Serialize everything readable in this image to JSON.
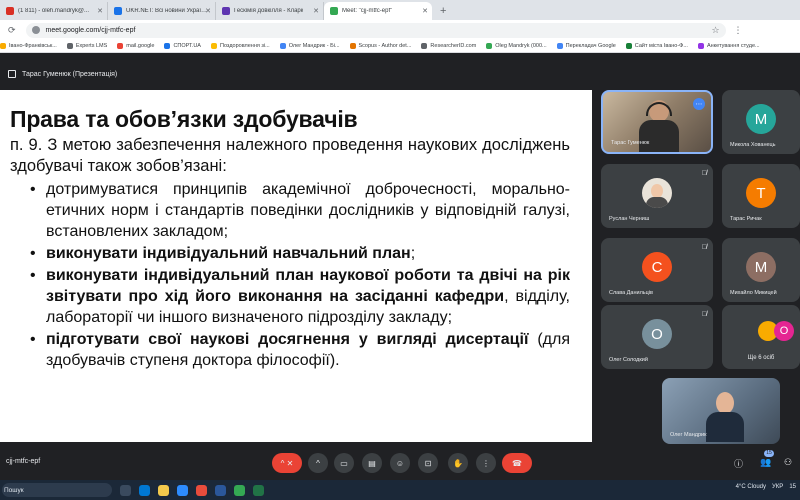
{
  "browser": {
    "tabs": [
      {
        "label": "(1 811) - oleh.mandryk@...",
        "color": "#d93025",
        "active": false
      },
      {
        "label": "UKR.NET: Всі новини України...",
        "color": "#1a73e8",
        "active": false
      },
      {
        "label": "Гескімія довкілля - Кларк",
        "color": "#5e35b1",
        "active": false
      },
      {
        "label": "Meet: \"cjj-mtfc-epf\"",
        "color": "#34a853",
        "active": true
      }
    ],
    "url": "meet.google.com/cjj-mtfc-epf",
    "bookmarks": [
      {
        "label": "Івано-Франківськ...",
        "color": "#f9ab00"
      },
      {
        "label": "Experts LMS",
        "color": "#5f6368"
      },
      {
        "label": "mail.google",
        "color": "#ea4335"
      },
      {
        "label": "СПОРТ.UA",
        "color": "#1a73e8"
      },
      {
        "label": "Поздоровлення зі...",
        "color": "#fbbc04"
      },
      {
        "label": "Олег Мандрик - Бі...",
        "color": "#4285f4"
      },
      {
        "label": "Scopus - Author det...",
        "color": "#e37400"
      },
      {
        "label": "ResearcherID.com",
        "color": "#5f6368"
      },
      {
        "label": "Oleg Mandryk (000...",
        "color": "#34a853"
      },
      {
        "label": "Перекладач Google",
        "color": "#4285f4"
      },
      {
        "label": "Сайт міста Івано-Ф...",
        "color": "#188038"
      },
      {
        "label": "Анкетування студе...",
        "color": "#9334e6"
      }
    ]
  },
  "meet": {
    "presenter": "Тарас Гуменюк (Презентація)",
    "meeting_code": "cjj-mtfc-epf",
    "participants_count": "15"
  },
  "slide": {
    "title": "Права та обов’язки здобувачів",
    "lead": "п. 9. З метою забезпечення належного проведення наукових досліджень здобувачі також зобов’язані:",
    "bullets": [
      {
        "text": "дотримуватися принципів академічної доброчесності, морально-етичних норм і стандартів поведінки дослідників у відповідній галузі, встановлених закладом;",
        "bold": "",
        "rest": ""
      },
      {
        "text": "",
        "bold": "виконувати індивідуальний навчальний план",
        "rest": ";"
      },
      {
        "text": "",
        "bold": "виконувати індивідуальний план наукової роботи та двічі на рік звітувати про хід його виконання на засіданні кафедри",
        "rest": ", відділу, лабораторії чи іншого визначеного підрозділу закладу;"
      },
      {
        "text": "",
        "bold": "підготувати свої наукові досягнення у вигляді дисертації",
        "rest": " (для здобувачів ступеня доктора філософії)."
      }
    ]
  },
  "participants": {
    "main": "Тарас Гуменюк",
    "mykola": {
      "name": "Микола Хованець",
      "initial": "M",
      "color": "#26a69a"
    },
    "ruslan": {
      "name": "Руслан Черниш"
    },
    "taras_r": {
      "name": "Тарас Ричак",
      "initial": "T",
      "color": "#f57c00"
    },
    "slava": {
      "name": "Слава Данильців",
      "initial": "C",
      "color": "#f4511e"
    },
    "mykhailo": {
      "name": "Михайло Микицей",
      "initial": "M",
      "color": "#8d6e63"
    },
    "oleh_s": {
      "name": "Олег Солодкий",
      "initial": "O",
      "color": "#78909c"
    },
    "more": {
      "label": "Ще 6 осіб",
      "initial": "O"
    },
    "self": "Олег Мандрик"
  },
  "taskbar": {
    "search": "Пошук",
    "weather": "4°C  Cloudy",
    "lang": "УКР",
    "time": "15"
  }
}
